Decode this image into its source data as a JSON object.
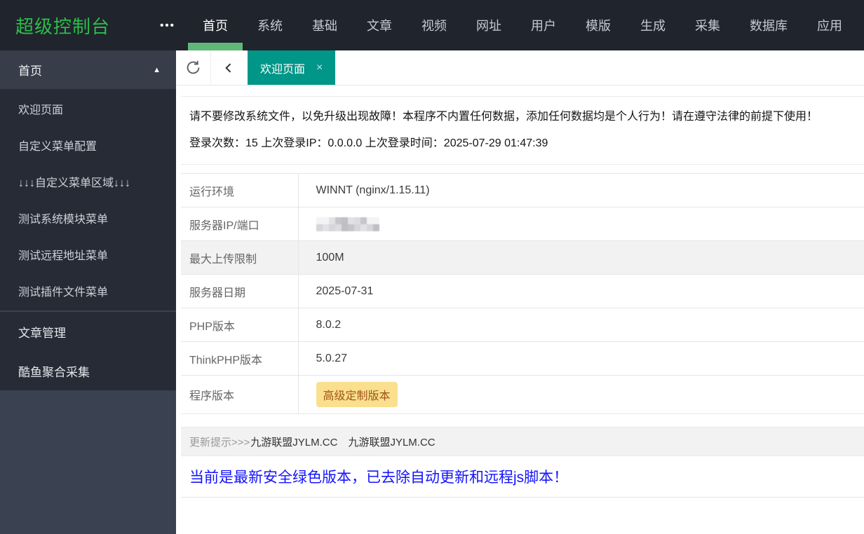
{
  "colors": {
    "topbar_bg": "#20242C",
    "sidebar_bg": "#3A4150",
    "sidebar_block_bg": "#262B35",
    "logo_green": "#2DBD4B",
    "nav_indicator_green": "#5FB878",
    "active_tab_teal": "#009688",
    "badge_bg": "#FAE08E",
    "badge_text": "#A0551A",
    "blue_notice_text": "#1414FE",
    "striped_row_bg": "#F2F2F2"
  },
  "topbar": {
    "logo": "超级控制台",
    "more_icon": "•••",
    "nav": [
      {
        "label": "首页",
        "active": true
      },
      {
        "label": "系统",
        "active": false
      },
      {
        "label": "基础",
        "active": false
      },
      {
        "label": "文章",
        "active": false
      },
      {
        "label": "视频",
        "active": false
      },
      {
        "label": "网址",
        "active": false
      },
      {
        "label": "用户",
        "active": false
      },
      {
        "label": "模版",
        "active": false
      },
      {
        "label": "生成",
        "active": false
      },
      {
        "label": "采集",
        "active": false
      },
      {
        "label": "数据库",
        "active": false
      },
      {
        "label": "应用",
        "active": false
      }
    ]
  },
  "sidebar": {
    "expanded_group": {
      "label": "首页",
      "collapse_icon": "▲",
      "items": [
        "欢迎页面",
        "自定义菜单配置",
        "↓↓↓自定义菜单区域↓↓↓",
        "测试系统模块菜单",
        "测试远程地址菜单",
        "测试插件文件菜单"
      ]
    },
    "collapsed_groups": [
      "文章管理",
      "酷鱼聚合采集"
    ]
  },
  "tabbar": {
    "tabs": [
      {
        "label": "欢迎页面",
        "active": true,
        "close_icon": "×"
      }
    ]
  },
  "notice": {
    "line1": "请不要修改系统文件，以免升级出现故障！本程序不内置任何数据，添加任何数据均是个人行为！请在遵守法律的前提下使用！",
    "login_count_label": "登录次数：",
    "login_count": "15",
    "last_ip_label": "上次登录IP：",
    "last_ip": "0.0.0.0",
    "last_time_label": "上次登录时间：",
    "last_time": "2025-07-29 01:47:39"
  },
  "info_table": {
    "rows": [
      {
        "label": "运行环境",
        "value": "WINNT (nginx/1.15.11)",
        "striped": false,
        "type": "text"
      },
      {
        "label": "服务器IP/端口",
        "value": "",
        "striped": false,
        "type": "redacted"
      },
      {
        "label": "最大上传限制",
        "value": "100M",
        "striped": true,
        "type": "text"
      },
      {
        "label": "服务器日期",
        "value": "2025-07-31",
        "striped": false,
        "type": "text"
      },
      {
        "label": "PHP版本",
        "value": "8.0.2",
        "striped": false,
        "type": "text"
      },
      {
        "label": "ThinkPHP版本",
        "value": "5.0.27",
        "striped": false,
        "type": "text"
      },
      {
        "label": "程序版本",
        "value": "高级定制版本",
        "striped": false,
        "type": "badge"
      }
    ]
  },
  "footer": {
    "update_label": "更新提示>>>",
    "update_text": "九游联盟JYLM.CC　九游联盟JYLM.CC",
    "blue_notice": "当前是最新安全绿色版本，已去除自动更新和远程js脚本！"
  }
}
